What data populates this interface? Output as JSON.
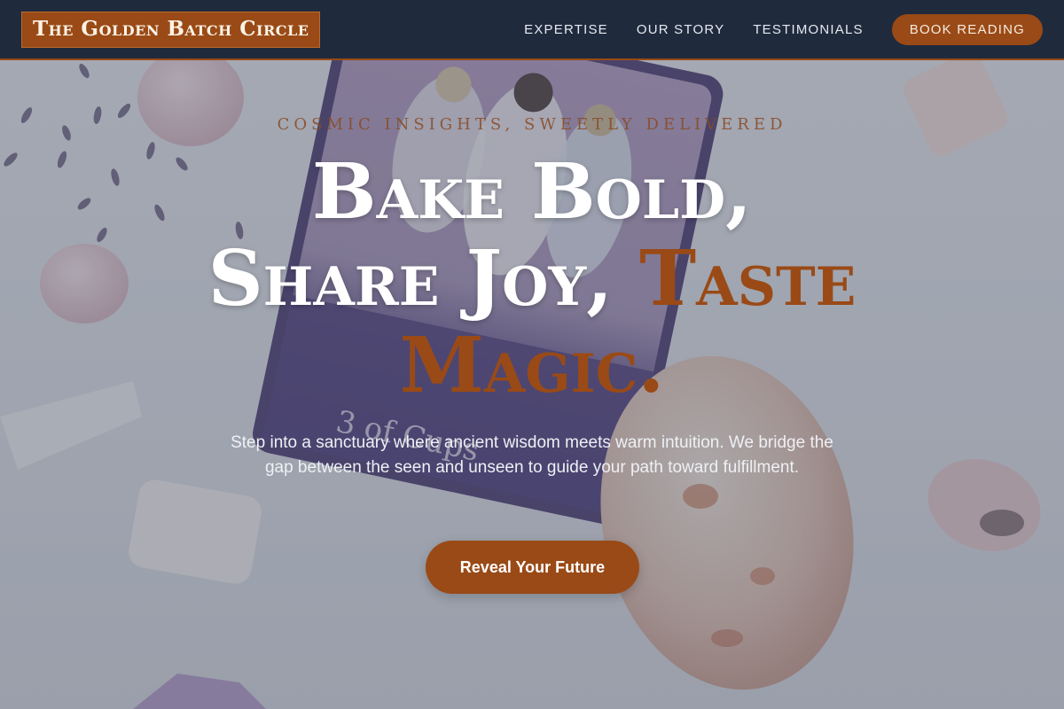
{
  "nav": {
    "brand": "The Golden Batch Circle",
    "links": [
      {
        "label": "EXPERTISE"
      },
      {
        "label": "OUR STORY"
      },
      {
        "label": "TESTIMONIALS"
      }
    ],
    "cta_label": "BOOK READING"
  },
  "hero": {
    "tagline": "Cosmic Insights, Sweetly Delivered",
    "headline_line1": "Bake Bold,",
    "headline_line2": "Share Joy,",
    "headline_accent": "Taste Magic.",
    "description": "Step into a sanctuary where ancient wisdom meets warm intuition. We bridge the gap between the seen and unseen to guide your path toward fulfillment.",
    "cta_label": "Reveal Your Future",
    "background_image": "tarot card among crystals and lavender",
    "card_caption": "3 of Cups"
  },
  "colors": {
    "navbar": "#1f2a3d",
    "accent": "#9a4a16",
    "headline": "#ffffff",
    "text": "#eef0f4"
  }
}
